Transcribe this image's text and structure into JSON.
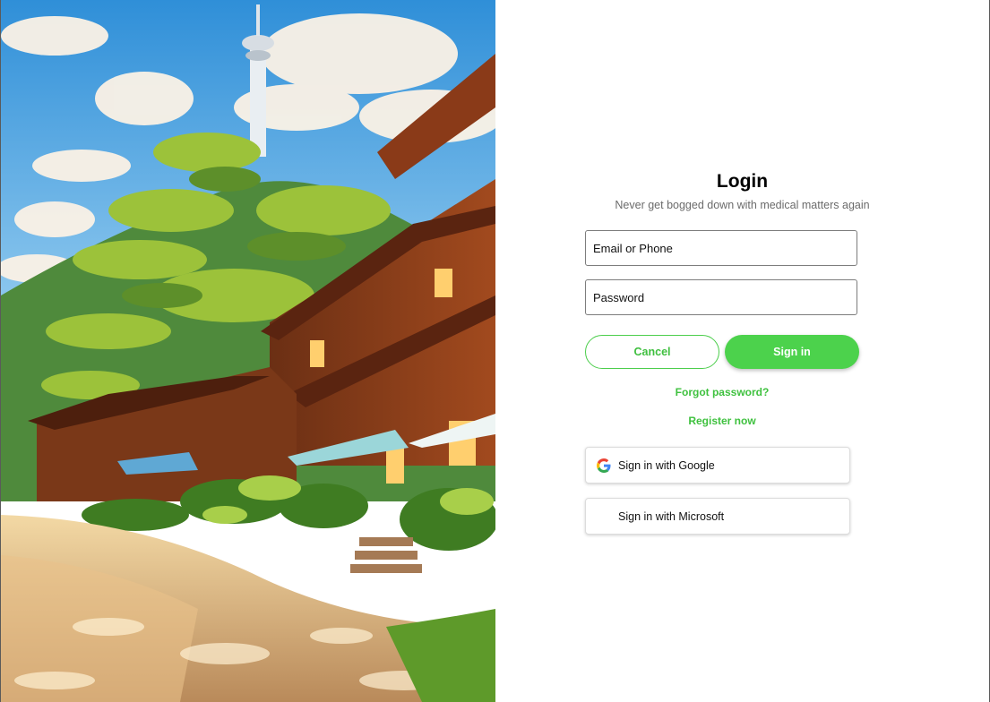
{
  "login": {
    "title": "Login",
    "subtitle": "Never get bogged down with medical matters again",
    "email_placeholder": "Email or Phone",
    "password_placeholder": "Password",
    "cancel_label": "Cancel",
    "signin_label": "Sign in",
    "forgot_label": "Forgot password?",
    "register_label": "Register now",
    "google_label": "Sign in with Google",
    "microsoft_label": "Sign in with Microsoft"
  },
  "colors": {
    "accent": "#4cd24c",
    "link": "#3fc13f",
    "subtitle": "#6b6b6b"
  },
  "icons": {
    "google": "google-icon",
    "microsoft": "microsoft-icon"
  }
}
